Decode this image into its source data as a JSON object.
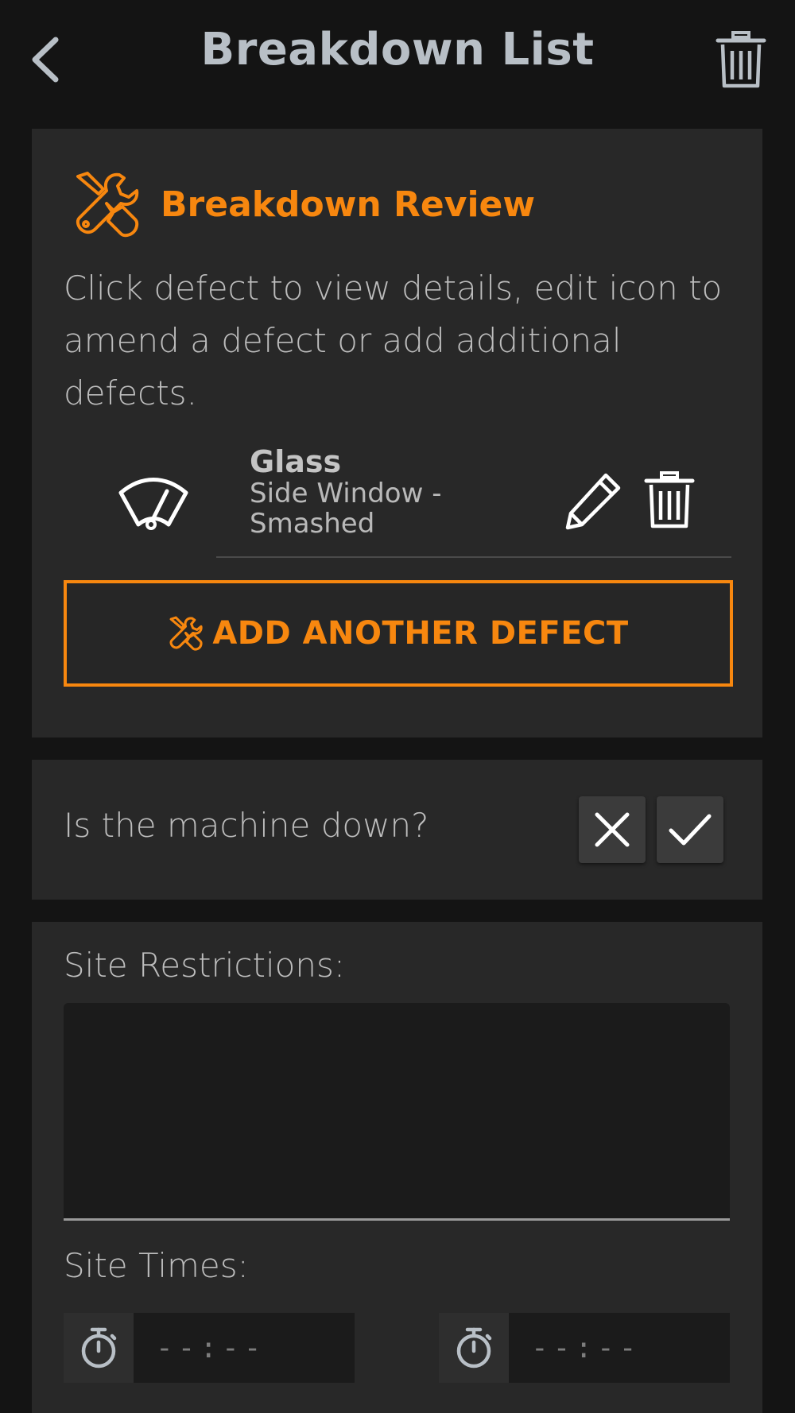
{
  "header": {
    "title": "Breakdown List"
  },
  "review": {
    "title": "Breakdown Review",
    "description": "Click defect to view details, edit icon to amend a defect or add additional defects.",
    "defects": [
      {
        "name": "Glass",
        "detail": "Side Window - Smashed",
        "icon": "windscreen-wiper-icon"
      }
    ],
    "add_button_label": "ADD ANOTHER DEFECT"
  },
  "machine": {
    "question": "Is the machine down?"
  },
  "site": {
    "restrictions_label": "Site Restrictions:",
    "restrictions_value": "",
    "times_label": "Site Times:",
    "start_time": "--:--",
    "end_time": "--:--"
  },
  "colors": {
    "accent": "#f7870f",
    "background": "#141414",
    "card": "#282828"
  }
}
